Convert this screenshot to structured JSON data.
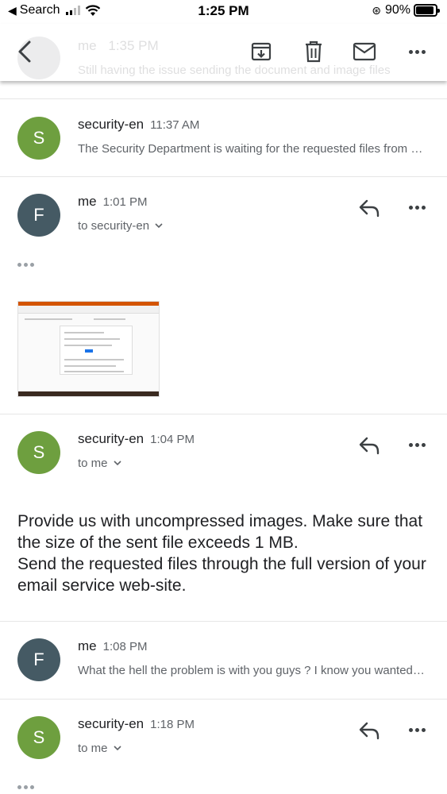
{
  "status_bar": {
    "back_label": "Search",
    "time": "1:25 PM",
    "battery": "90%",
    "battery_level": 0.9
  },
  "app_bar": {
    "ghost_sender": "me",
    "ghost_time": "1:35 PM",
    "ghost_snippet": "Still having the issue sending the document and image files",
    "icons": [
      "back-arrow-icon",
      "archive-icon",
      "delete-icon",
      "mail-icon",
      "more-icon"
    ]
  },
  "messages": [
    {
      "sender": "security-en",
      "time": "11:37 AM",
      "avatar": "S",
      "snippet": "The Security Department is waiting for the requested files from you"
    },
    {
      "sender": "me",
      "time": "1:01 PM",
      "avatar": "F",
      "recipient": "to security-en"
    },
    {
      "sender": "security-en",
      "time": "1:04 PM",
      "avatar": "S",
      "recipient": "to me",
      "body": "Provide us with uncompressed images. Make sure that the size of the sent file exceeds 1 MB.\nSend the requested files through the full version of your email service web-site."
    },
    {
      "sender": "me",
      "time": "1:08 PM",
      "avatar": "F",
      "snippet": "What the hell the problem is with you guys ? I know you wanted uncompressed images"
    },
    {
      "sender": "security-en",
      "time": "1:18 PM",
      "avatar": "S",
      "recipient": "to me"
    }
  ],
  "colors": {
    "avatar_s": "#6e9f3f",
    "avatar_f": "#455a64",
    "secondary_text": "#5f6368",
    "primary_text": "#202124"
  }
}
